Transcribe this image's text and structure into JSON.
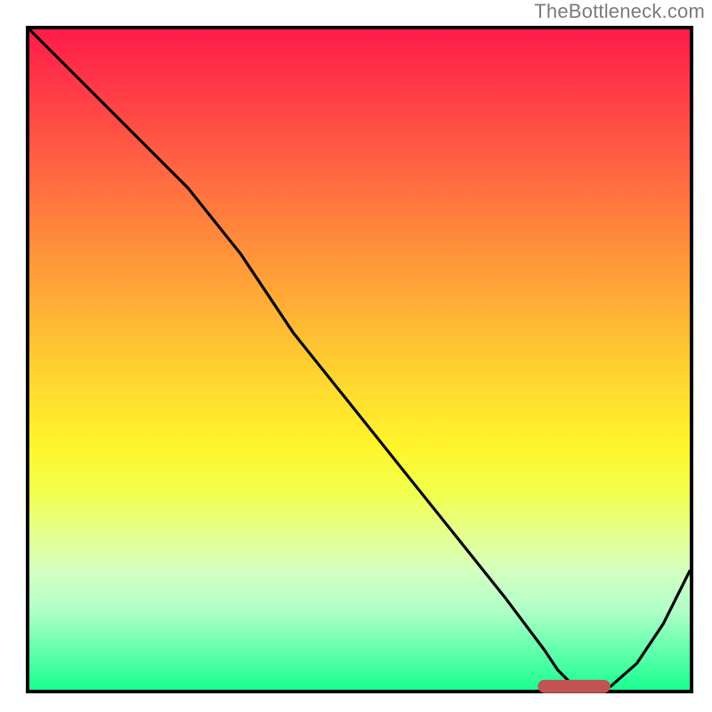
{
  "credit": "TheBottleneck.com",
  "chart_data": {
    "type": "line",
    "title": "",
    "xlabel": "",
    "ylabel": "",
    "xlim": [
      0,
      100
    ],
    "ylim": [
      0,
      100
    ],
    "grid": false,
    "series": [
      {
        "name": "bottleneck-curve",
        "x": [
          0,
          8,
          16,
          24,
          32,
          40,
          48,
          56,
          64,
          72,
          78,
          80,
          82,
          85,
          88,
          92,
          96,
          100
        ],
        "values": [
          100,
          92,
          84,
          76,
          66,
          54,
          44,
          34,
          24,
          14,
          6,
          3,
          1,
          0.5,
          0.5,
          4,
          10,
          18
        ]
      }
    ],
    "marker": {
      "name": "optimal-range",
      "shape": "rounded-rect",
      "x_center": 82.5,
      "y_center": 0.5,
      "width": 11,
      "height": 2,
      "color": "#c15353"
    },
    "description": "Qualitative bottleneck curve over a red-to-green vertical gradient; minimum (optimal zone) marked by a short rounded red-brown bar near x≈82."
  }
}
